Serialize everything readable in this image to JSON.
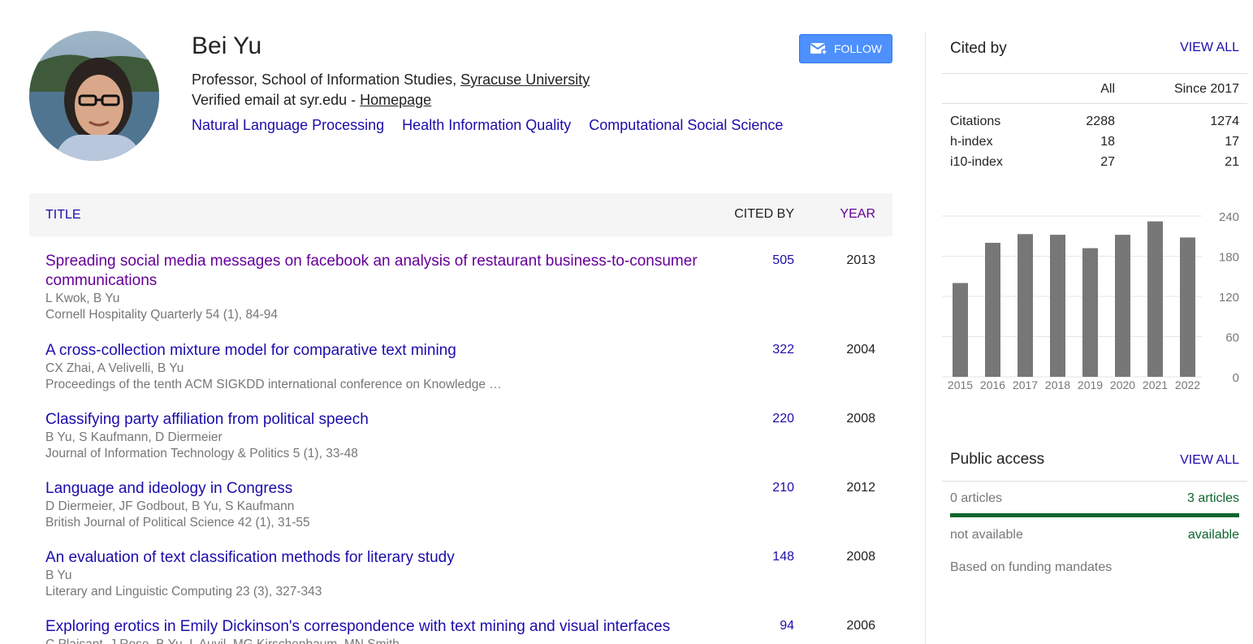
{
  "profile": {
    "name": "Bei Yu",
    "affiliation_prefix": "Professor, School of Information Studies, ",
    "affiliation_link": "Syracuse University",
    "email_prefix": "Verified email at syr.edu - ",
    "homepage_link": "Homepage",
    "interests": [
      "Natural Language Processing",
      "Health Information Quality",
      "Computational Social Science"
    ],
    "follow_label": "FOLLOW"
  },
  "table": {
    "header": {
      "title": "TITLE",
      "cited_by": "CITED BY",
      "year": "YEAR"
    },
    "rows": [
      {
        "title": "Spreading social media messages on facebook an analysis of restaurant business-to-consumer communications",
        "authors": "L Kwok, B Yu",
        "venue": "Cornell Hospitality Quarterly 54 (1), 84-94",
        "cited": "505",
        "year": "2013"
      },
      {
        "title": "A cross-collection mixture model for comparative text mining",
        "authors": "CX Zhai, A Velivelli, B Yu",
        "venue": "Proceedings of the tenth ACM SIGKDD international conference on Knowledge …",
        "cited": "322",
        "year": "2004"
      },
      {
        "title": "Classifying party affiliation from political speech",
        "authors": "B Yu, S Kaufmann, D Diermeier",
        "venue": "Journal of Information Technology & Politics 5 (1), 33-48",
        "cited": "220",
        "year": "2008"
      },
      {
        "title": "Language and ideology in Congress",
        "authors": "D Diermeier, JF Godbout, B Yu, S Kaufmann",
        "venue": "British Journal of Political Science 42 (1), 31-55",
        "cited": "210",
        "year": "2012"
      },
      {
        "title": "An evaluation of text classification methods for literary study",
        "authors": "B Yu",
        "venue": "Literary and Linguistic Computing 23 (3), 327-343",
        "cited": "148",
        "year": "2008"
      },
      {
        "title": "Exploring erotics in Emily Dickinson's correspondence with text mining and visual interfaces",
        "authors": "C Plaisant, J Rose, B Yu, L Auvil, MG Kirschenbaum, MN Smith",
        "venue": "",
        "cited": "94",
        "year": "2006"
      }
    ]
  },
  "cited_by": {
    "heading": "Cited by",
    "view_all": "VIEW ALL",
    "col_all": "All",
    "col_since": "Since 2017",
    "rows": [
      {
        "label": "Citations",
        "all": "2288",
        "since": "1274"
      },
      {
        "label": "h-index",
        "all": "18",
        "since": "17"
      },
      {
        "label": "i10-index",
        "all": "27",
        "since": "21"
      }
    ]
  },
  "chart_data": {
    "type": "bar",
    "categories": [
      "2015",
      "2016",
      "2017",
      "2018",
      "2019",
      "2020",
      "2021",
      "2022"
    ],
    "values": [
      140,
      200,
      213,
      212,
      192,
      212,
      232,
      208
    ],
    "ylim": [
      0,
      240
    ],
    "yticks": [
      "0",
      "60",
      "120",
      "180",
      "240"
    ],
    "bar_color": "#777777",
    "grid": true
  },
  "public_access": {
    "heading": "Public access",
    "view_all": "VIEW ALL",
    "left_count": "0 articles",
    "right_count": "3 articles",
    "left_status": "not available",
    "right_status": "available",
    "note": "Based on funding mandates"
  }
}
